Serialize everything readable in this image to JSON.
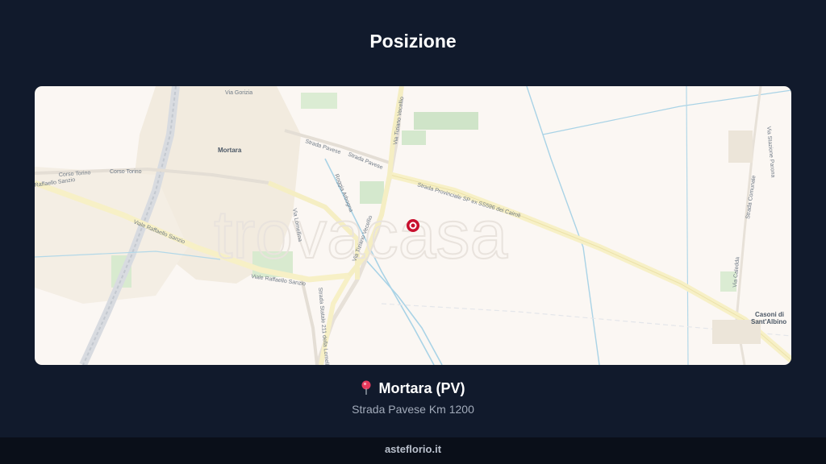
{
  "page": {
    "title": "Posizione"
  },
  "map": {
    "watermark": "trovacasa",
    "places": {
      "town": "Mortara",
      "village_line1": "Casoni di",
      "village_line2": "Sant'Albino"
    },
    "streets": {
      "via_gorizia": "Via Gorizia",
      "strada_pavese_1": "Strada Pavese",
      "strada_pavese_2": "Strada Pavese",
      "via_tiziano_vecellio_top": "Via Tiziano Vecellio",
      "corso_torino_1": "Corso Torino",
      "corso_torino_2": "Corso Torino",
      "raffaello_sanzio_left": "Raffaello Sanzio",
      "viale_raffaello_sanzio_1": "Viale Raffaello Sanzio",
      "viale_raffaello_sanzio_2": "Viale Raffaello Sanzio",
      "sp_label": "Strada Provinciale SP  ex SS596 dei Cairoli",
      "via_lomellina": "Via Lomellina",
      "via_tiziano_vecellio": "Via Tiziano Vecellio",
      "roggia_arbogna": "Roggia Arbogna",
      "ss_lomellina": "Strada Statale 211 della Lomellina",
      "strada_comunale": "Strada Comunale",
      "via_caledda": "Via Caledda",
      "via_stazione": "Via Stazione Parona"
    },
    "marker_color": "#c8102e"
  },
  "location": {
    "pin_icon": "round-pushpin-icon",
    "city": "Mortara (PV)",
    "address": "Strada Pavese Km 1200"
  },
  "footer": {
    "site": "asteflorio.it"
  }
}
